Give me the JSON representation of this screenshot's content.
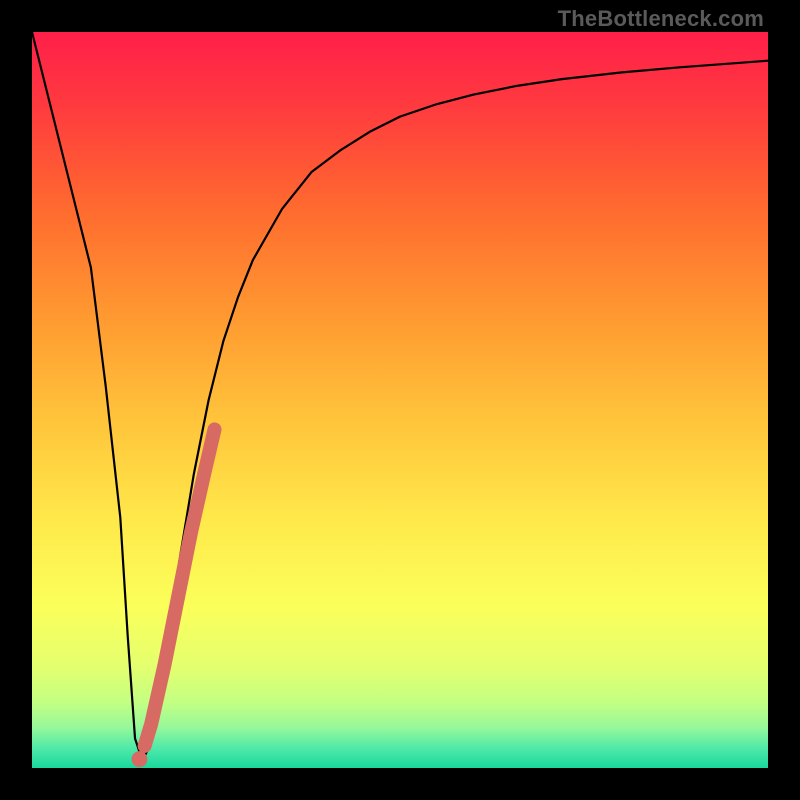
{
  "watermark": "TheBottleneck.com",
  "colors": {
    "curve": "#000000",
    "highlight": "#d76b63",
    "frame": "#000000"
  },
  "chart_data": {
    "type": "line",
    "title": "",
    "xlabel": "",
    "ylabel": "",
    "xlim": [
      0,
      100
    ],
    "ylim": [
      0,
      100
    ],
    "grid": false,
    "legend": false,
    "series": [
      {
        "name": "bottleneck-curve",
        "x": [
          0,
          2,
          4,
          6,
          8,
          10,
          12,
          13,
          14,
          15,
          16,
          18,
          20,
          22,
          24,
          26,
          28,
          30,
          34,
          38,
          42,
          46,
          50,
          55,
          60,
          66,
          72,
          80,
          88,
          96,
          100
        ],
        "y": [
          100,
          92,
          84,
          76,
          68,
          52,
          34,
          18,
          4,
          1,
          3,
          14,
          28,
          40,
          50,
          58,
          64,
          69,
          76,
          81,
          84,
          86.5,
          88.5,
          90.2,
          91.5,
          92.7,
          93.6,
          94.5,
          95.2,
          95.8,
          96.1
        ]
      },
      {
        "name": "highlight-segment",
        "x": [
          15.3,
          16.2,
          18.0,
          19.8,
          21.6,
          23.4,
          24.8
        ],
        "y": [
          3.0,
          6.0,
          14.0,
          23.0,
          32.0,
          40.0,
          46.0
        ]
      },
      {
        "name": "highlight-dot",
        "x": [
          14.6
        ],
        "y": [
          1.2
        ]
      }
    ],
    "gradient_stops": [
      {
        "offset": 0.0,
        "color": "#ff1f49"
      },
      {
        "offset": 0.1,
        "color": "#ff3a3f"
      },
      {
        "offset": 0.24,
        "color": "#ff6a2f"
      },
      {
        "offset": 0.38,
        "color": "#ff9730"
      },
      {
        "offset": 0.52,
        "color": "#ffc23a"
      },
      {
        "offset": 0.66,
        "color": "#ffe84a"
      },
      {
        "offset": 0.78,
        "color": "#fbff5a"
      },
      {
        "offset": 0.86,
        "color": "#e5ff6e"
      },
      {
        "offset": 0.91,
        "color": "#c4ff82"
      },
      {
        "offset": 0.945,
        "color": "#96f89a"
      },
      {
        "offset": 0.975,
        "color": "#4be8a9"
      },
      {
        "offset": 1.0,
        "color": "#18d99b"
      }
    ]
  }
}
